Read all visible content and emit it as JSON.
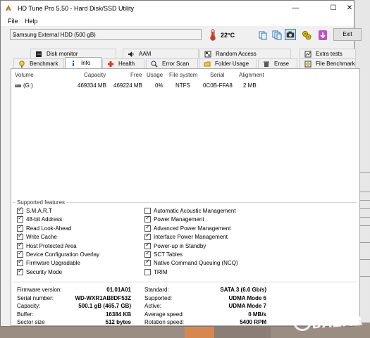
{
  "window": {
    "title": "HD Tune Pro 5.50 - Hard Disk/SSD Utility",
    "controls": {
      "minimize": "—",
      "maximize": "☐",
      "close": "✕"
    }
  },
  "menu": [
    "File",
    "Help"
  ],
  "toolbar": {
    "drive": "Samsung External HDD (500 gB)",
    "temperature": "22°C",
    "exit_label": "Exit",
    "icons": [
      "copy-icon",
      "copy-all-icon",
      "screenshot-icon",
      "options-icon",
      "save-icon"
    ]
  },
  "tabs": {
    "row1": [
      "Disk monitor",
      "AAM",
      "Random Access",
      "Extra tests"
    ],
    "row2": [
      "Benchmark",
      "Info",
      "Health",
      "Error Scan",
      "Folder Usage",
      "Erase",
      "File Benchmark"
    ],
    "selected": "Info"
  },
  "volumes": {
    "headers": [
      "Volume",
      "Capacity",
      "Free",
      "Usage",
      "File system",
      "Serial",
      "Alignment"
    ],
    "rows": [
      [
        "(G:)",
        "469334 MB",
        "469224 MB",
        "0%",
        "NTFS",
        "0C0B-FFA8",
        "2 MB"
      ]
    ]
  },
  "features": {
    "title": "Supported features",
    "left": [
      {
        "label": "S.M.A.R.T",
        "checked": true
      },
      {
        "label": "48-bit Address",
        "checked": true
      },
      {
        "label": "Read Look-Ahead",
        "checked": true
      },
      {
        "label": "Write Cache",
        "checked": true
      },
      {
        "label": "Host Protected Area",
        "checked": true
      },
      {
        "label": "Device Configuration Overlay",
        "checked": true
      },
      {
        "label": "Firmware Upgradable",
        "checked": true
      },
      {
        "label": "Security Mode",
        "checked": true
      }
    ],
    "right": [
      {
        "label": "Automatic Acoustic Management",
        "checked": false
      },
      {
        "label": "Power Management",
        "checked": true
      },
      {
        "label": "Advanced Power Management",
        "checked": true
      },
      {
        "label": "Interface Power Management",
        "checked": true
      },
      {
        "label": "Power-up in Standby",
        "checked": true
      },
      {
        "label": "SCT Tables",
        "checked": true
      },
      {
        "label": "Native Command Queuing (NCQ)",
        "checked": true
      },
      {
        "label": "TRIM",
        "checked": false
      }
    ]
  },
  "info": {
    "left": [
      {
        "label": "Firmware version:",
        "value": "01.01A01"
      },
      {
        "label": "Serial number:",
        "value": "WD-WXR1AB8DF53Z"
      },
      {
        "label": "Capacity:",
        "value": "500.1 gB (465.7 GB)"
      },
      {
        "label": "Buffer:",
        "value": "16384 KB"
      },
      {
        "label": "Sector size",
        "value": "512 bytes"
      }
    ],
    "right": [
      {
        "label": "Standard:",
        "value": "SATA 3 (6.0 Gb/s)"
      },
      {
        "label": "Supported:",
        "value": "UDMA Mode 6"
      },
      {
        "label": "Active:",
        "value": "UDMA Mode 7"
      },
      {
        "label": "Average speed:",
        "value": "0 MB/s"
      },
      {
        "label": "Rotation speed:",
        "value": "5400 RPM"
      }
    ]
  },
  "watermark": "BAZAR",
  "colors": {
    "accent": "#3a78c9",
    "window_bg": "#f0f0f0",
    "panel_bg": "#ffffff"
  }
}
